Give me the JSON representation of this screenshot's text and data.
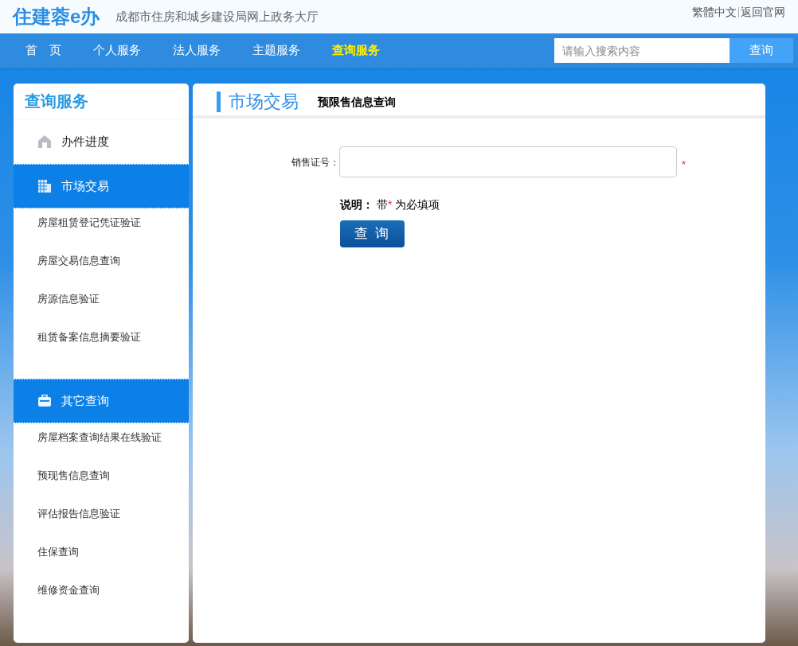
{
  "header": {
    "logo": "住建蓉e办",
    "subtitle": "成都市住房和城乡建设局网上政务大厅",
    "links": [
      "繁體中文",
      "返回官网"
    ]
  },
  "nav": {
    "items": [
      {
        "label": "首　页",
        "selected": false
      },
      {
        "label": "个人服务",
        "selected": false
      },
      {
        "label": "法人服务",
        "selected": false
      },
      {
        "label": "主题服务",
        "selected": false
      },
      {
        "label": "查询服务",
        "selected": true
      }
    ],
    "search": {
      "placeholder": "请输入搜索内容",
      "button": "查询"
    }
  },
  "sidebar": {
    "title": "查询服务",
    "groups": [
      {
        "label": "办件进度",
        "expanded": false
      },
      {
        "label": "市场交易",
        "expanded": true,
        "children": [
          "房屋租赁登记凭证验证",
          "房屋交易信息查询",
          "房源信息验证",
          "租赁备案信息摘要验证"
        ]
      },
      {
        "label": "其它查询",
        "expanded": true,
        "children": [
          "房屋档案查询结果在线验证",
          "预现售信息查询",
          "评估报告信息验证",
          "住保查询",
          "维修资金查询"
        ]
      }
    ]
  },
  "main": {
    "section": "市场交易",
    "page_title": "预限售信息查询",
    "field": {
      "label": "销售证号：",
      "required_mark": "*"
    },
    "note": {
      "label": "说明：",
      "text": "带",
      "mark": "*",
      "rest": "为必填项"
    },
    "button": "查 询"
  }
}
